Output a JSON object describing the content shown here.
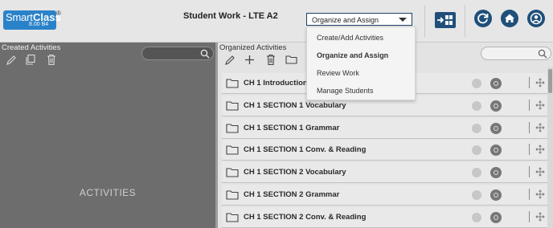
{
  "header": {
    "logo_smart": "Smart",
    "logo_class": "Class",
    "logo_version": "8.00 B4",
    "logo_reg": "®",
    "title": "Student Work - LTE A2",
    "mode_select_value": "Organize and Assign"
  },
  "mode_menu": {
    "items": [
      {
        "label": "Create/Add Activities",
        "active": false
      },
      {
        "label": "Organize and Assign",
        "active": true
      },
      {
        "label": "Review Work",
        "active": false
      },
      {
        "label": "Manage Students",
        "active": false
      }
    ]
  },
  "header_icons": [
    "switch-layout-icon",
    "refresh-icon",
    "home-icon",
    "user-icon"
  ],
  "left_panel": {
    "title": "Created Activities",
    "placeholder_text": "ACTIVITIES",
    "tools": [
      "edit-icon",
      "copy-icon",
      "trash-icon"
    ]
  },
  "right_panel": {
    "title": "Organized Activities",
    "tools": [
      "edit-icon",
      "add-icon",
      "trash-icon",
      "folder-icon"
    ],
    "folders": [
      {
        "label": "CH 1 Introduction"
      },
      {
        "label": "CH 1 SECTION 1 Vocabulary"
      },
      {
        "label": "CH 1 SECTION 1 Grammar"
      },
      {
        "label": "CH 1 SECTION 1 Conv. & Reading"
      },
      {
        "label": "CH 1 SECTION 2 Vocabulary"
      },
      {
        "label": "CH 1 SECTION 2 Grammar"
      },
      {
        "label": "CH 1 SECTION 2 Conv. & Reading"
      }
    ]
  },
  "colors": {
    "brand_blue": "#2a82c9",
    "header_icon_navy": "#1f4f7a",
    "left_panel_bg": "#6d6d6d"
  }
}
